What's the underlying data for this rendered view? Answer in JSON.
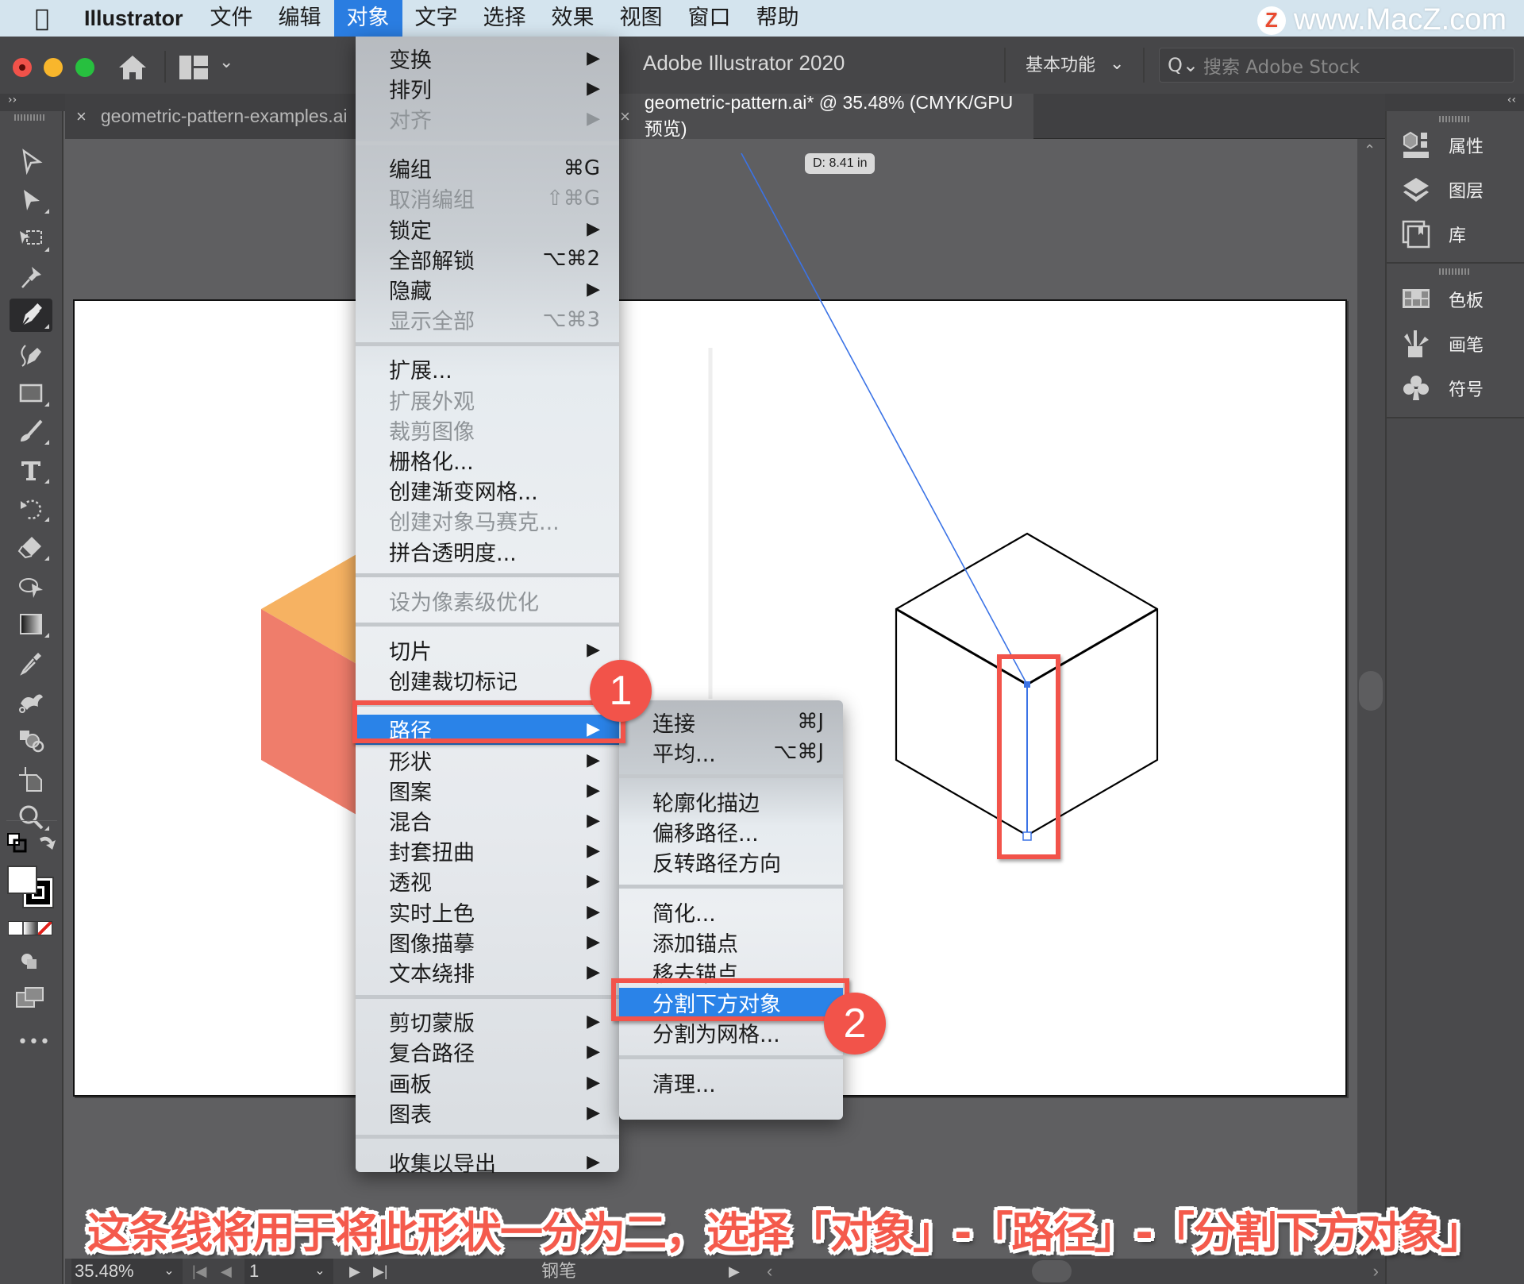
{
  "menubar": {
    "apple": "",
    "app_name": "Illustrator",
    "items": [
      "文件",
      "编辑",
      "对象",
      "文字",
      "选择",
      "效果",
      "视图",
      "窗口",
      "帮助"
    ],
    "active_index": 2
  },
  "watermark": {
    "logo": "Z",
    "text": "www.MacZ.com"
  },
  "titlebar": {
    "app_title": "Adobe Illustrator 2020",
    "workspace": "基本功能",
    "workspace_chevron": "⌄",
    "search_icon": "Q⌄",
    "search_placeholder": "搜索 Adobe Stock"
  },
  "panels": {
    "left_collapse": "››",
    "right_collapse": "‹‹"
  },
  "tabs": [
    {
      "label": "geometric-pattern-examples.ai",
      "close": "×",
      "active": false
    },
    {
      "label": "geometric-pattern.ai* @ 35.48% (CMYK/GPU 预览)",
      "close": "×",
      "active": true
    }
  ],
  "canvas": {
    "distance_readout": "D: 8.41 in",
    "colors": {
      "hex_orange": "#f6b262",
      "hex_red": "#ef7d6b",
      "path_blue": "#3b73e6",
      "cube_stroke": "#000000"
    }
  },
  "toolbar": {
    "tools": [
      {
        "name": "selection-tool"
      },
      {
        "name": "direct-selection-tool"
      },
      {
        "name": "artboard-tool"
      },
      {
        "name": "puppet-warp-tool"
      },
      {
        "name": "pen-tool",
        "active": true
      },
      {
        "name": "curvature-tool"
      },
      {
        "name": "rectangle-tool"
      },
      {
        "name": "paintbrush-tool"
      },
      {
        "name": "type-tool"
      },
      {
        "name": "rotate-tool"
      },
      {
        "name": "eraser-tool"
      },
      {
        "name": "free-transform-tool"
      },
      {
        "name": "gradient-tool"
      },
      {
        "name": "eyedropper-tool"
      },
      {
        "name": "blend-tool"
      },
      {
        "name": "shape-builder-tool"
      },
      {
        "name": "crop-tool"
      },
      {
        "name": "zoom-tool"
      }
    ],
    "fill_color": "#ffffff",
    "stroke_color": "#000000",
    "more": "•••"
  },
  "right_panel": {
    "group1": [
      "属性",
      "图层",
      "库"
    ],
    "group2": [
      "色板",
      "画笔",
      "符号"
    ]
  },
  "object_menu": {
    "items": [
      {
        "label": "变换",
        "shortcut": "",
        "submenu": true,
        "disabled": false
      },
      {
        "label": "排列",
        "shortcut": "",
        "submenu": true,
        "disabled": false
      },
      {
        "label": "对齐",
        "shortcut": "",
        "submenu": true,
        "disabled": true
      },
      {
        "sep": true
      },
      {
        "label": "编组",
        "shortcut": "⌘G",
        "submenu": false,
        "disabled": false
      },
      {
        "label": "取消编组",
        "shortcut": "⇧⌘G",
        "submenu": false,
        "disabled": true
      },
      {
        "label": "锁定",
        "shortcut": "",
        "submenu": true,
        "disabled": false
      },
      {
        "label": "全部解锁",
        "shortcut": "⌥⌘2",
        "submenu": false,
        "disabled": false
      },
      {
        "label": "隐藏",
        "shortcut": "",
        "submenu": true,
        "disabled": false
      },
      {
        "label": "显示全部",
        "shortcut": "⌥⌘3",
        "submenu": false,
        "disabled": true
      },
      {
        "sep": true
      },
      {
        "label": "扩展...",
        "shortcut": "",
        "submenu": false,
        "disabled": false
      },
      {
        "label": "扩展外观",
        "shortcut": "",
        "submenu": false,
        "disabled": true
      },
      {
        "label": "裁剪图像",
        "shortcut": "",
        "submenu": false,
        "disabled": true
      },
      {
        "label": "栅格化...",
        "shortcut": "",
        "submenu": false,
        "disabled": false
      },
      {
        "label": "创建渐变网格...",
        "shortcut": "",
        "submenu": false,
        "disabled": false
      },
      {
        "label": "创建对象马赛克...",
        "shortcut": "",
        "submenu": false,
        "disabled": true
      },
      {
        "label": "拼合透明度...",
        "shortcut": "",
        "submenu": false,
        "disabled": false
      },
      {
        "sep": true
      },
      {
        "label": "设为像素级优化",
        "shortcut": "",
        "submenu": false,
        "disabled": true
      },
      {
        "sep": true
      },
      {
        "label": "切片",
        "shortcut": "",
        "submenu": true,
        "disabled": false
      },
      {
        "label": "创建裁切标记",
        "shortcut": "",
        "submenu": false,
        "disabled": false
      },
      {
        "sep": true
      },
      {
        "label": "路径",
        "shortcut": "",
        "submenu": true,
        "disabled": false,
        "highlighted": true
      },
      {
        "label": "形状",
        "shortcut": "",
        "submenu": true,
        "disabled": false
      },
      {
        "label": "图案",
        "shortcut": "",
        "submenu": true,
        "disabled": false
      },
      {
        "label": "混合",
        "shortcut": "",
        "submenu": true,
        "disabled": false
      },
      {
        "label": "封套扭曲",
        "shortcut": "",
        "submenu": true,
        "disabled": false
      },
      {
        "label": "透视",
        "shortcut": "",
        "submenu": true,
        "disabled": false
      },
      {
        "label": "实时上色",
        "shortcut": "",
        "submenu": true,
        "disabled": false
      },
      {
        "label": "图像描摹",
        "shortcut": "",
        "submenu": true,
        "disabled": false
      },
      {
        "label": "文本绕排",
        "shortcut": "",
        "submenu": true,
        "disabled": false
      },
      {
        "sep": true
      },
      {
        "label": "剪切蒙版",
        "shortcut": "",
        "submenu": true,
        "disabled": false
      },
      {
        "label": "复合路径",
        "shortcut": "",
        "submenu": true,
        "disabled": false
      },
      {
        "label": "画板",
        "shortcut": "",
        "submenu": true,
        "disabled": false
      },
      {
        "label": "图表",
        "shortcut": "",
        "submenu": true,
        "disabled": false
      },
      {
        "sep": true
      },
      {
        "label": "收集以导出",
        "shortcut": "",
        "submenu": true,
        "disabled": false
      }
    ]
  },
  "path_submenu": {
    "items": [
      {
        "label": "连接",
        "shortcut": "⌘J"
      },
      {
        "label": "平均...",
        "shortcut": "⌥⌘J"
      },
      {
        "sep": true
      },
      {
        "label": "轮廓化描边",
        "shortcut": ""
      },
      {
        "label": "偏移路径...",
        "shortcut": ""
      },
      {
        "label": "反转路径方向",
        "shortcut": ""
      },
      {
        "sep": true
      },
      {
        "label": "简化...",
        "shortcut": ""
      },
      {
        "label": "添加锚点",
        "shortcut": ""
      },
      {
        "label": "移去锚点",
        "shortcut": ""
      },
      {
        "label": "分割下方对象",
        "shortcut": "",
        "highlighted": true
      },
      {
        "label": "分割为网格...",
        "shortcut": ""
      },
      {
        "sep": true
      },
      {
        "label": "清理...",
        "shortcut": ""
      }
    ]
  },
  "annotations": {
    "badge1": "1",
    "badge2": "2",
    "caption": "这条线将用于将此形状一分为二，选择「对象」-「路径」-「分割下方对象」",
    "accent": "#f2534a"
  },
  "statusbar": {
    "zoom": "35.48%",
    "zoom_chevron": "⌄",
    "first": "|◀",
    "prev": "◀",
    "page": "1",
    "page_chevron": "⌄",
    "next": "▶",
    "last": "▶|",
    "tool_name": "钢笔",
    "more": "▶",
    "scroll_left": "‹",
    "scroll_right": "›"
  }
}
